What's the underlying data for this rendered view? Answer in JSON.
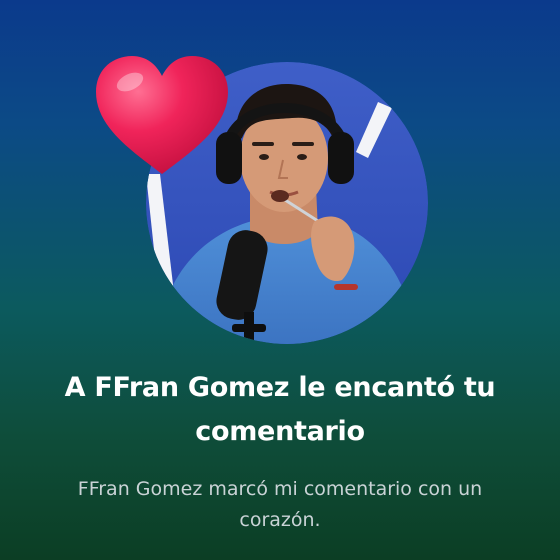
{
  "notification": {
    "title": "A FFran Gomez le encantó tu comentario",
    "body": "FFran Gomez marcó mi comentario con un corazón."
  },
  "avatar": {
    "subject": "man with headphones and microphone"
  },
  "reaction": {
    "icon": "heart-icon",
    "color": "#f0245a"
  },
  "colors": {
    "background_top": "#0b3a8c",
    "background_bottom": "#0c3e24",
    "title_text": "#ffffff",
    "body_text": "#c9d3d6"
  }
}
